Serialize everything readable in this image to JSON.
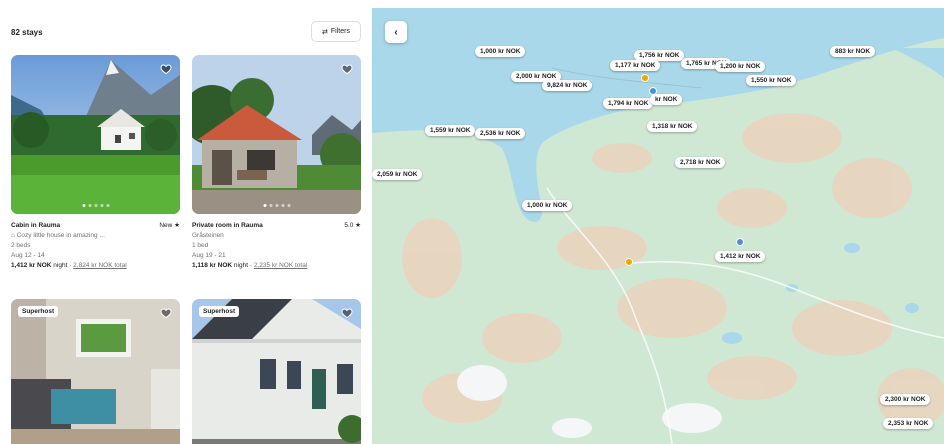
{
  "header": {
    "stays_count": "82 stays",
    "filters_label": "Filters"
  },
  "listings": [
    {
      "title": "Cabin in Rauma",
      "rating": "New ★",
      "description": "Cozy little house in amazing ...",
      "beds": "2 beds",
      "dates": "Aug 12 - 14",
      "price": "1,412 kr NOK",
      "price_unit": "night",
      "total": "2,824 kr NOK total",
      "badge": ""
    },
    {
      "title": "Private room in Rauma",
      "rating": "5.0 ★",
      "description": "Gråsteinen",
      "beds": "1 bed",
      "dates": "Aug 19 - 21",
      "price": "1,118 kr NOK",
      "price_unit": "night",
      "total": "2,235 kr NOK total",
      "badge": ""
    },
    {
      "title": "",
      "rating": "",
      "description": "",
      "beds": "",
      "dates": "",
      "price": "",
      "price_unit": "",
      "total": "",
      "badge": "Superhost"
    },
    {
      "title": "",
      "rating": "",
      "description": "",
      "beds": "",
      "dates": "",
      "price": "",
      "price_unit": "",
      "total": "",
      "badge": "Superhost"
    }
  ],
  "map": {
    "pins": [
      "1,000 kr NOK",
      "2,000 kr NOK",
      "9,824 kr NOK",
      "1,756 kr NOK",
      "1,177 kr NOK",
      "1,765 kr NOK",
      "1,200 kr NOK",
      "1,550 kr NOK",
      "883 kr NOK",
      "1,794 kr NOK",
      "kr NOK",
      "1,559 kr NOK",
      "2,536 kr NOK",
      "1,318 kr NOK",
      "2,059 kr NOK",
      "2,718 kr NOK",
      "1,000 kr NOK",
      "1,412 kr NOK",
      "2,300 kr NOK",
      "2,353 kr NOK"
    ],
    "colors": {
      "water": "#a8d8ea",
      "land": "#cfe8d3",
      "terrain": "#e9d5bf"
    }
  }
}
